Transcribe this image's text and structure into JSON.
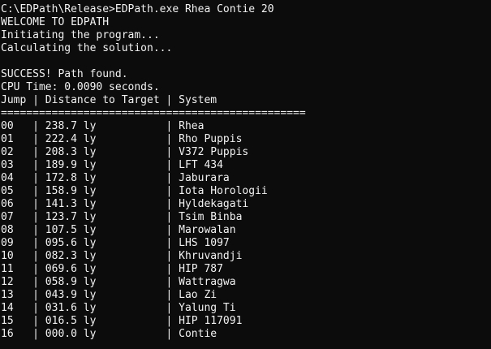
{
  "console": {
    "command_line": "C:\\EDPath\\Release>EDPath.exe Rhea Contie 20",
    "welcome": "WELCOME TO EDPATH",
    "initiating": "Initiating the program...",
    "calculating": "Calculating the solution...",
    "success": "SUCCESS! Path found.",
    "cpu_time": "CPU Time: 0.0090 seconds.",
    "table_header": "Jump | Distance to Target | System",
    "separator": "================================================",
    "rows": [
      "00   | 238.7 ly           | Rhea",
      "01   | 222.4 ly           | Rho Puppis",
      "02   | 208.3 ly           | V372 Puppis",
      "03   | 189.9 ly           | LFT 434",
      "04   | 172.8 ly           | Jaburara",
      "05   | 158.9 ly           | Iota Horologii",
      "06   | 141.3 ly           | Hyldekagati",
      "07   | 123.7 ly           | Tsim Binba",
      "08   | 107.5 ly           | Marowalan",
      "09   | 095.6 ly           | LHS 1097",
      "10   | 082.3 ly           | Khruvandji",
      "11   | 069.6 ly           | HIP 787",
      "12   | 058.9 ly           | Wattragwa",
      "13   | 043.9 ly           | Lao Zi",
      "14   | 031.6 ly           | Yalung Ti",
      "15   | 016.5 ly           | HIP 117091",
      "16   | 000.0 ly           | Contie"
    ]
  }
}
